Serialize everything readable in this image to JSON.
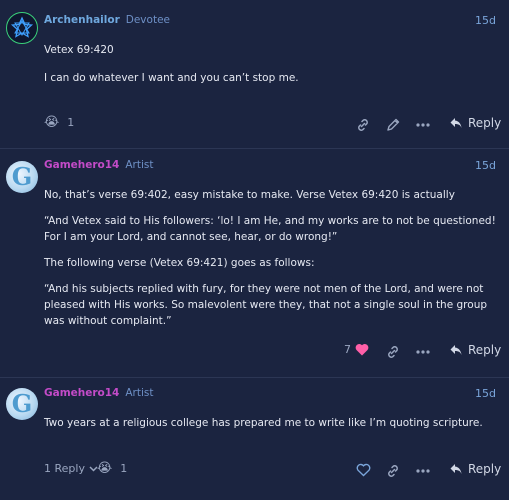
{
  "posts": [
    {
      "username": "Archenhailor",
      "user_title": "Devotee",
      "date": "15d",
      "name_color": "#6fa8de",
      "paragraphs": [
        "Vetex 69:420",
        "I can do whatever I want and you can’t stop me."
      ],
      "reaction_emoji": "😭",
      "reaction_count": "1",
      "reply_label": "Reply"
    },
    {
      "username": "Gamehero14",
      "user_title": "Artist",
      "date": "15d",
      "name_color": "#c34bc8",
      "paragraphs": [
        "No, that’s verse 69:402, easy mistake to make. Verse Vetex 69:420 is actually",
        "“And Vetex said to His followers: ‘lo! I am He, and my works are to not be questioned! For I am your Lord, and cannot see, hear, or do wrong!”",
        "The following verse (Vetex 69:421) goes as follows:",
        "“And his subjects replied with fury, for they were not men of the Lord, and were not pleased with His works. So malevolent were they, that not a single soul in the group was without complaint.”"
      ],
      "like_count": "7",
      "reply_label": "Reply"
    },
    {
      "username": "Gamehero14",
      "user_title": "Artist",
      "date": "15d",
      "name_color": "#c34bc8",
      "paragraphs": [
        "Two years at a religious college has prepared me to write like I’m quoting scripture."
      ],
      "replies_label": "1 Reply",
      "reaction_emoji": "😭",
      "reaction_count": "1",
      "reply_label": "Reply"
    }
  ],
  "colors": {
    "like_heart": "#ff5fa8",
    "accent": "#7aa5da"
  },
  "icons": [
    "star-avatar-icon",
    "g-avatar-icon",
    "link-icon",
    "pencil-icon",
    "more-icon",
    "reply-arrow-icon",
    "heart-icon",
    "chevron-down-icon"
  ]
}
